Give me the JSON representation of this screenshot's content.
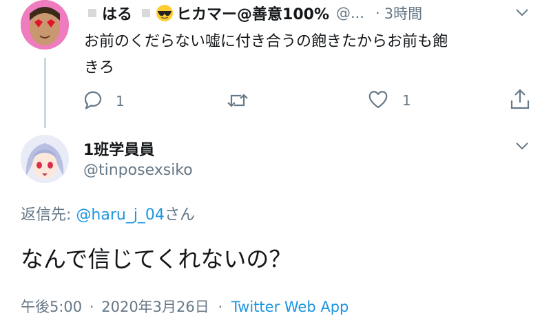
{
  "parent": {
    "name_part1": "はる",
    "name_part2": "ヒカマー@善意100%",
    "handle": "@...",
    "sep": "·",
    "time": "3時間",
    "text_line1": "お前のくだらない嘘に付き合うの飽きたからお前も飽",
    "text_line2": "きろ",
    "reply_count": "1",
    "like_count": "1"
  },
  "reply": {
    "name": "1班学員員",
    "handle": "@tinposexsiko",
    "replying_prefix": "返信先: ",
    "replying_user": "@haru_j_04",
    "replying_suffix": "さん",
    "text": "なんで信じてくれないの？",
    "time": "午後5:00",
    "sep1": "·",
    "date": "2020年3月26日",
    "sep2": "·",
    "source": "Twitter Web App"
  },
  "colors": {
    "accent": "#1b95e0",
    "secondary": "#657786",
    "thread": "#ccd6dd"
  },
  "icons": [
    "chevron-down-icon",
    "reply-icon",
    "retweet-icon",
    "like-icon",
    "share-icon",
    "sunglasses-emoji-icon"
  ]
}
